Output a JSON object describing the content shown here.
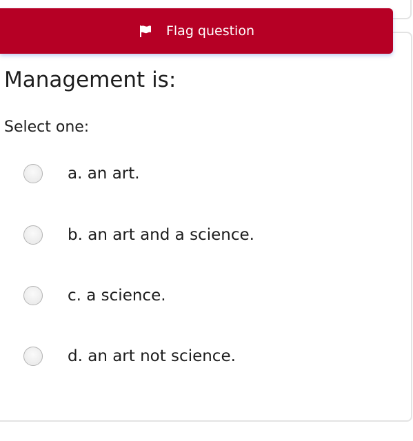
{
  "flag": {
    "label": "Flag question",
    "icon": "flag-icon",
    "color": "#b60025"
  },
  "question": {
    "text": "Management is:",
    "prompt": "Select one:",
    "options": [
      {
        "letter": "a.",
        "label": "a. an art."
      },
      {
        "letter": "b.",
        "label": "b. an art and a science."
      },
      {
        "letter": "c.",
        "label": "c. a science."
      },
      {
        "letter": "d.",
        "label": "d. an art not science."
      }
    ]
  }
}
